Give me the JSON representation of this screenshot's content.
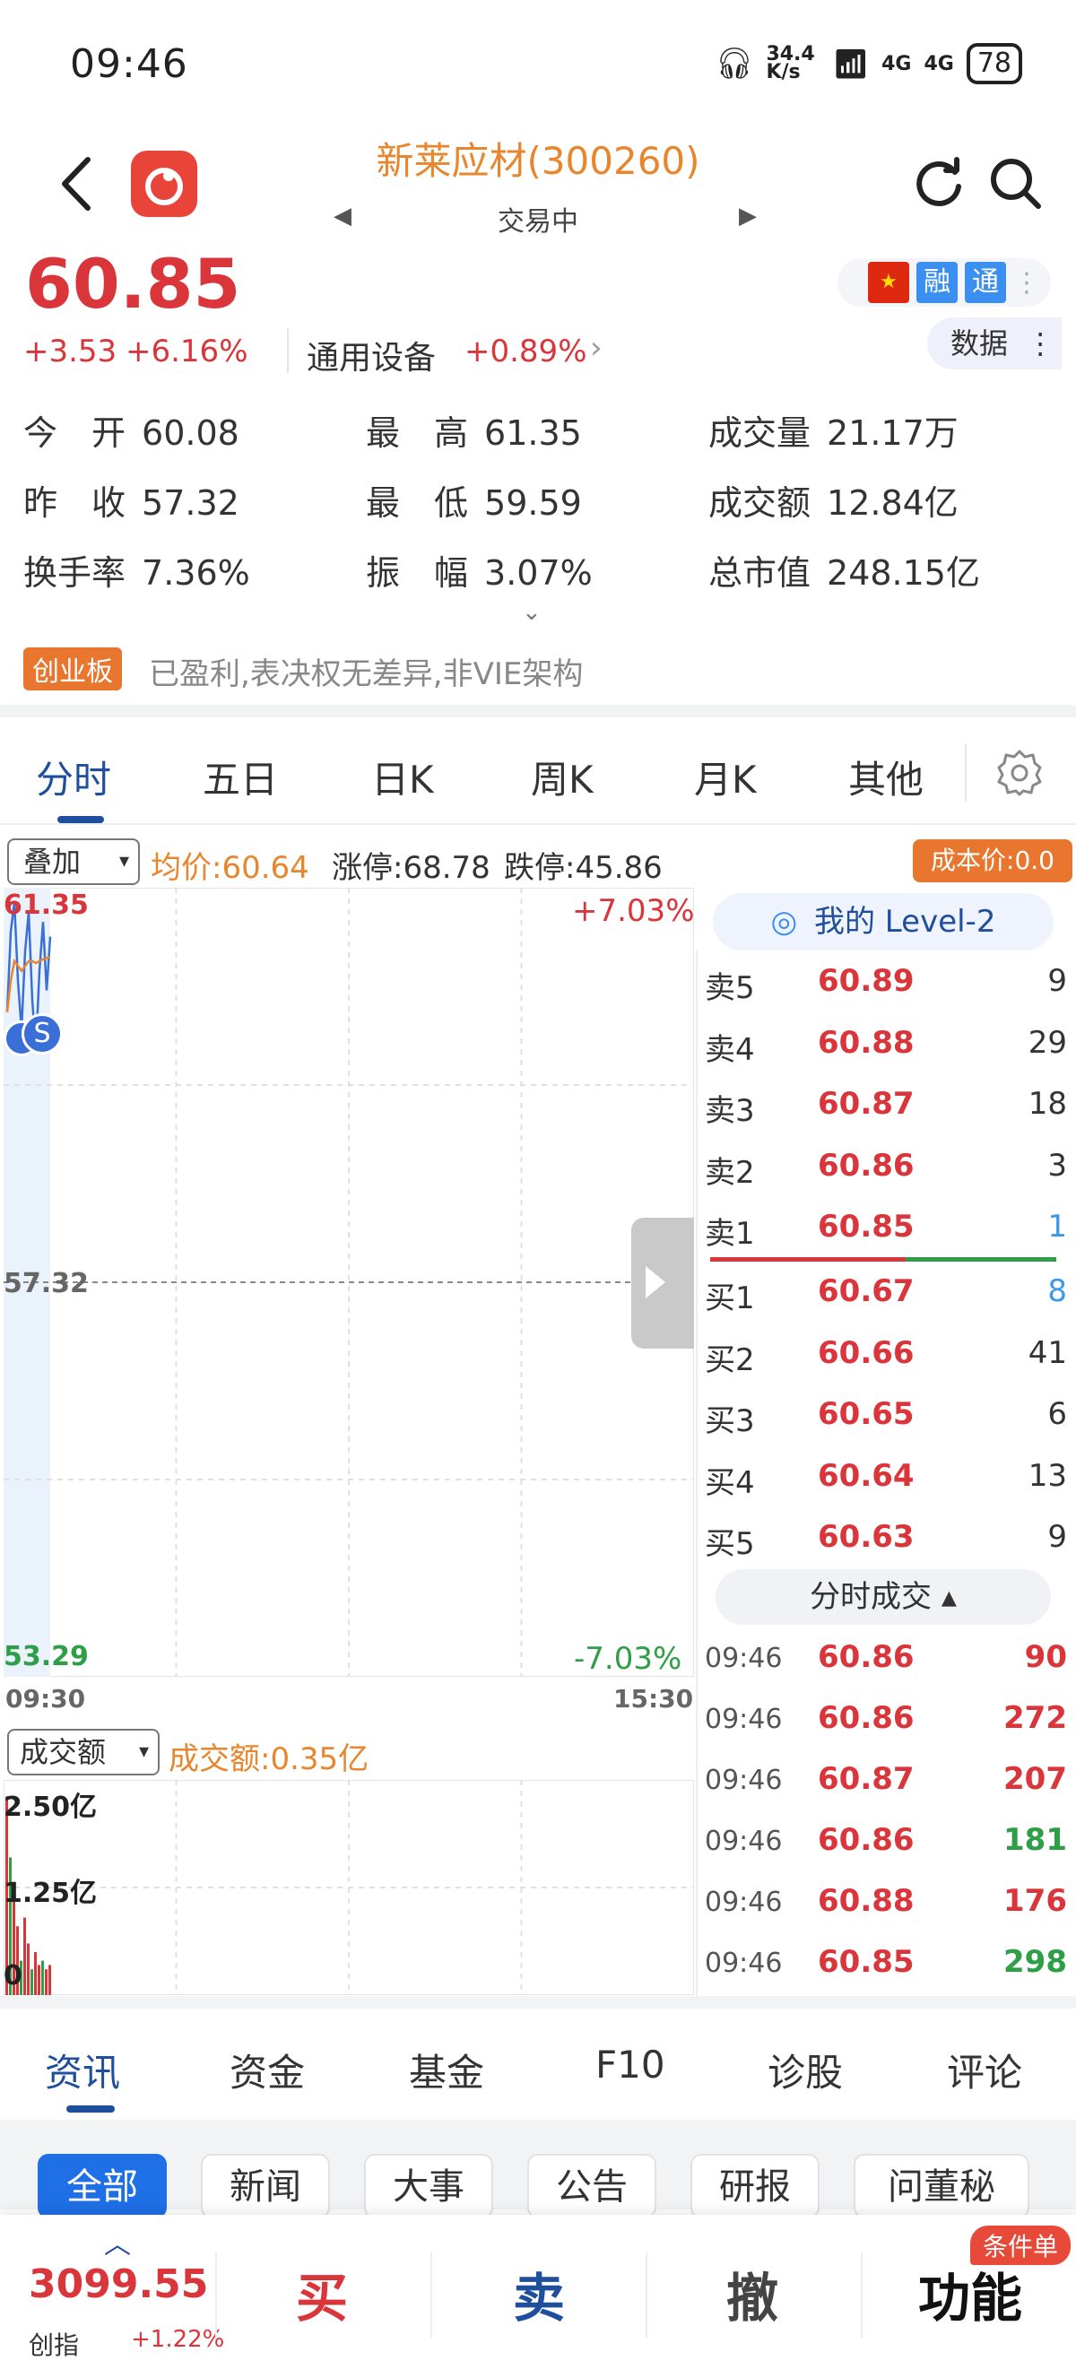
{
  "status_bar": {
    "time": "09:46",
    "net_speed": "34.4 K/s",
    "signal_1": "4G",
    "signal_2": "4G",
    "battery": "78"
  },
  "header": {
    "title": "新莱应材(300260)",
    "status": "交易中",
    "prev_glyph": "◀",
    "next_glyph": "▶"
  },
  "quote": {
    "price": "60.85",
    "change": "+3.53",
    "change_pct": "+6.16%",
    "industry": "通用设备",
    "industry_pct": "+0.89%",
    "industry_chevron": "›",
    "badges": {
      "rong": "融",
      "tong": "通"
    },
    "data_button": "数据"
  },
  "stats": [
    {
      "key": "今　开",
      "value": "60.08"
    },
    {
      "key": "最　高",
      "value": "61.35"
    },
    {
      "key": "成交量",
      "value": "21.17万"
    },
    {
      "key": "昨　收",
      "value": "57.32"
    },
    {
      "key": "最　低",
      "value": "59.59"
    },
    {
      "key": "成交额",
      "value": "12.84亿"
    },
    {
      "key": "换手率",
      "value": "7.36%"
    },
    {
      "key": "振　幅",
      "value": "3.07%"
    },
    {
      "key": "总市值",
      "value": "248.15亿"
    }
  ],
  "board": {
    "tag": "创业板",
    "desc": "已盈利,表决权无差异,非VIE架构"
  },
  "chart_tabs": [
    "分时",
    "五日",
    "日K",
    "周K",
    "月K",
    "其他"
  ],
  "chart_header": {
    "overlay": "叠加",
    "avg_price": "均价:60.64",
    "limit_up": "涨停:68.78",
    "limit_down": "跌停:45.86",
    "cost": "成本价:0.0"
  },
  "chart_data": [
    {
      "type": "line",
      "y_top": "61.35",
      "y_mid": "57.32",
      "y_bottom": "53.29",
      "pct_top": "+7.03%",
      "pct_bottom": "-7.03%",
      "x_start": "09:30",
      "x_end": "15:30",
      "ylim": [
        53.29,
        61.35
      ],
      "prev_close": 57.32,
      "series": [
        {
          "values": [
            60.08,
            60.9,
            61.2,
            60.4,
            59.9,
            60.7,
            61.1,
            60.2,
            59.7,
            60.5,
            61.0,
            60.3,
            60.85
          ]
        },
        {
          "values": [
            60.08,
            60.4,
            60.6,
            60.55,
            60.5,
            60.55,
            60.6,
            60.6,
            60.58,
            60.6,
            60.62,
            60.63,
            60.64
          ]
        }
      ]
    },
    {
      "type": "bar",
      "selector": "成交额",
      "amount": "成交额:0.35亿",
      "y_top": "2.50亿",
      "y_mid": "1.25亿",
      "y_bottom": "0",
      "ylim": [
        0,
        2.5
      ],
      "values": [
        2.3,
        1.6,
        1.1,
        0.8,
        0.4,
        0.9,
        0.6,
        0.3,
        0.5,
        0.35,
        0.4,
        0.3,
        0.35
      ]
    }
  ],
  "level2": "我的 Level-2",
  "asks": [
    {
      "label": "卖5",
      "price": "60.89",
      "qty": "9"
    },
    {
      "label": "卖4",
      "price": "60.88",
      "qty": "29"
    },
    {
      "label": "卖3",
      "price": "60.87",
      "qty": "18"
    },
    {
      "label": "卖2",
      "price": "60.86",
      "qty": "3"
    },
    {
      "label": "卖1",
      "price": "60.85",
      "qty": "1"
    }
  ],
  "bids": [
    {
      "label": "买1",
      "price": "60.67",
      "qty": "8"
    },
    {
      "label": "买2",
      "price": "60.66",
      "qty": "41"
    },
    {
      "label": "买3",
      "price": "60.65",
      "qty": "6"
    },
    {
      "label": "买4",
      "price": "60.64",
      "qty": "13"
    },
    {
      "label": "买5",
      "price": "60.63",
      "qty": "9"
    }
  ],
  "ticks_toggle": "分时成交 ▴",
  "ticks": [
    {
      "time": "09:46",
      "price": "60.86",
      "vol": "90",
      "dir": "red"
    },
    {
      "time": "09:46",
      "price": "60.86",
      "vol": "272",
      "dir": "red"
    },
    {
      "time": "09:46",
      "price": "60.87",
      "vol": "207",
      "dir": "red"
    },
    {
      "time": "09:46",
      "price": "60.86",
      "vol": "181",
      "dir": "green"
    },
    {
      "time": "09:46",
      "price": "60.88",
      "vol": "176",
      "dir": "red"
    },
    {
      "time": "09:46",
      "price": "60.85",
      "vol": "298",
      "dir": "green"
    }
  ],
  "info_tabs": [
    "资讯",
    "资金",
    "基金",
    "F10",
    "诊股",
    "评论"
  ],
  "info_chips": [
    "全部",
    "新闻",
    "大事",
    "公告",
    "研报",
    "问董秘"
  ],
  "bottom_bar": {
    "index_value": "3099.55",
    "index_name": "创指",
    "index_pct": "+1.22%",
    "buy": "买",
    "sell": "卖",
    "cancel": "撤",
    "function": "功能",
    "cond_badge": "条件单"
  },
  "colors": {
    "up": "#d9353b",
    "down": "#2e9e47",
    "accent": "#1f4e9c",
    "orange": "#e8862e"
  }
}
